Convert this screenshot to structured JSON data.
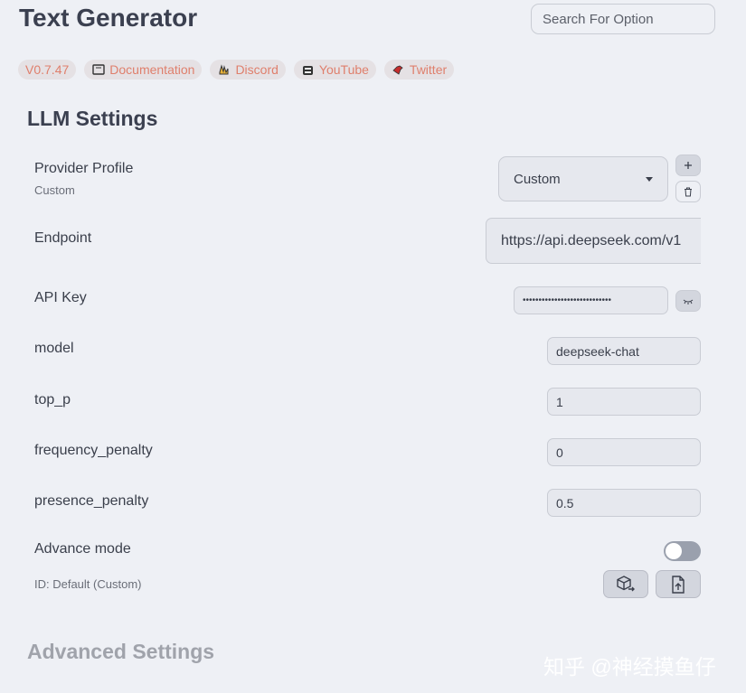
{
  "app": {
    "title": "Text Generator"
  },
  "search": {
    "placeholder": "Search For Option"
  },
  "badges": [
    {
      "label": "V0.7.47",
      "icon": ""
    },
    {
      "label": "Documentation",
      "icon": "book-icon"
    },
    {
      "label": "Discord",
      "icon": "discord-icon"
    },
    {
      "label": "YouTube",
      "icon": "youtube-icon"
    },
    {
      "label": "Twitter",
      "icon": "twitter-icon"
    }
  ],
  "llm": {
    "title": "LLM Settings",
    "provider": {
      "label": "Provider Profile",
      "sublabel": "Custom",
      "selected": "Custom"
    },
    "endpoint": {
      "label": "Endpoint",
      "value": "https://api.deepseek.com/v1"
    },
    "api_key": {
      "label": "API Key",
      "value": "••••••••••••••••••••••••••••"
    },
    "model": {
      "label": "model",
      "value": "deepseek-chat"
    },
    "top_p": {
      "label": "top_p",
      "value": "1"
    },
    "frequency_penalty": {
      "label": "frequency_penalty",
      "value": "0"
    },
    "presence_penalty": {
      "label": "presence_penalty",
      "value": "0.5"
    },
    "advance_mode": {
      "label": "Advance mode",
      "enabled": false
    },
    "id_text": "ID: Default (Custom)"
  },
  "advanced": {
    "title": "Advanced Settings"
  },
  "watermark": "知乎 @神经摸鱼仔",
  "colors": {
    "accent": "#df7f6c",
    "background": "#eef0f5",
    "badge_bg": "#e5e1e4"
  }
}
